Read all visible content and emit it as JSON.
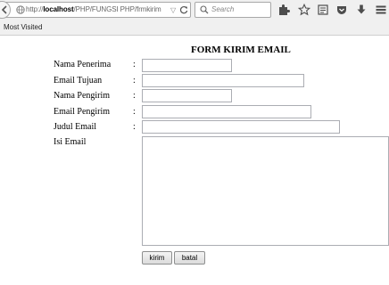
{
  "browser": {
    "url_prefix": "http://",
    "url_host": "localhost",
    "url_path": "/PHP/FUNGSI PHP/frmkirim",
    "search_placeholder": "Search",
    "bookmarks_label": "Most Visited"
  },
  "form": {
    "title": "FORM KIRIM EMAIL",
    "separator": ":",
    "fields": {
      "nama_penerima": {
        "label": "Nama Penerima",
        "value": ""
      },
      "email_tujuan": {
        "label": "Email Tujuan",
        "value": ""
      },
      "nama_pengirim": {
        "label": "Nama Pengirim",
        "value": ""
      },
      "email_pengirim": {
        "label": "Email Pengirim",
        "value": ""
      },
      "judul_email": {
        "label": "Judul Email",
        "value": ""
      },
      "isi_email": {
        "label": "Isi Email",
        "value": ""
      }
    },
    "buttons": {
      "kirim": "kirim",
      "batal": "batal"
    }
  }
}
